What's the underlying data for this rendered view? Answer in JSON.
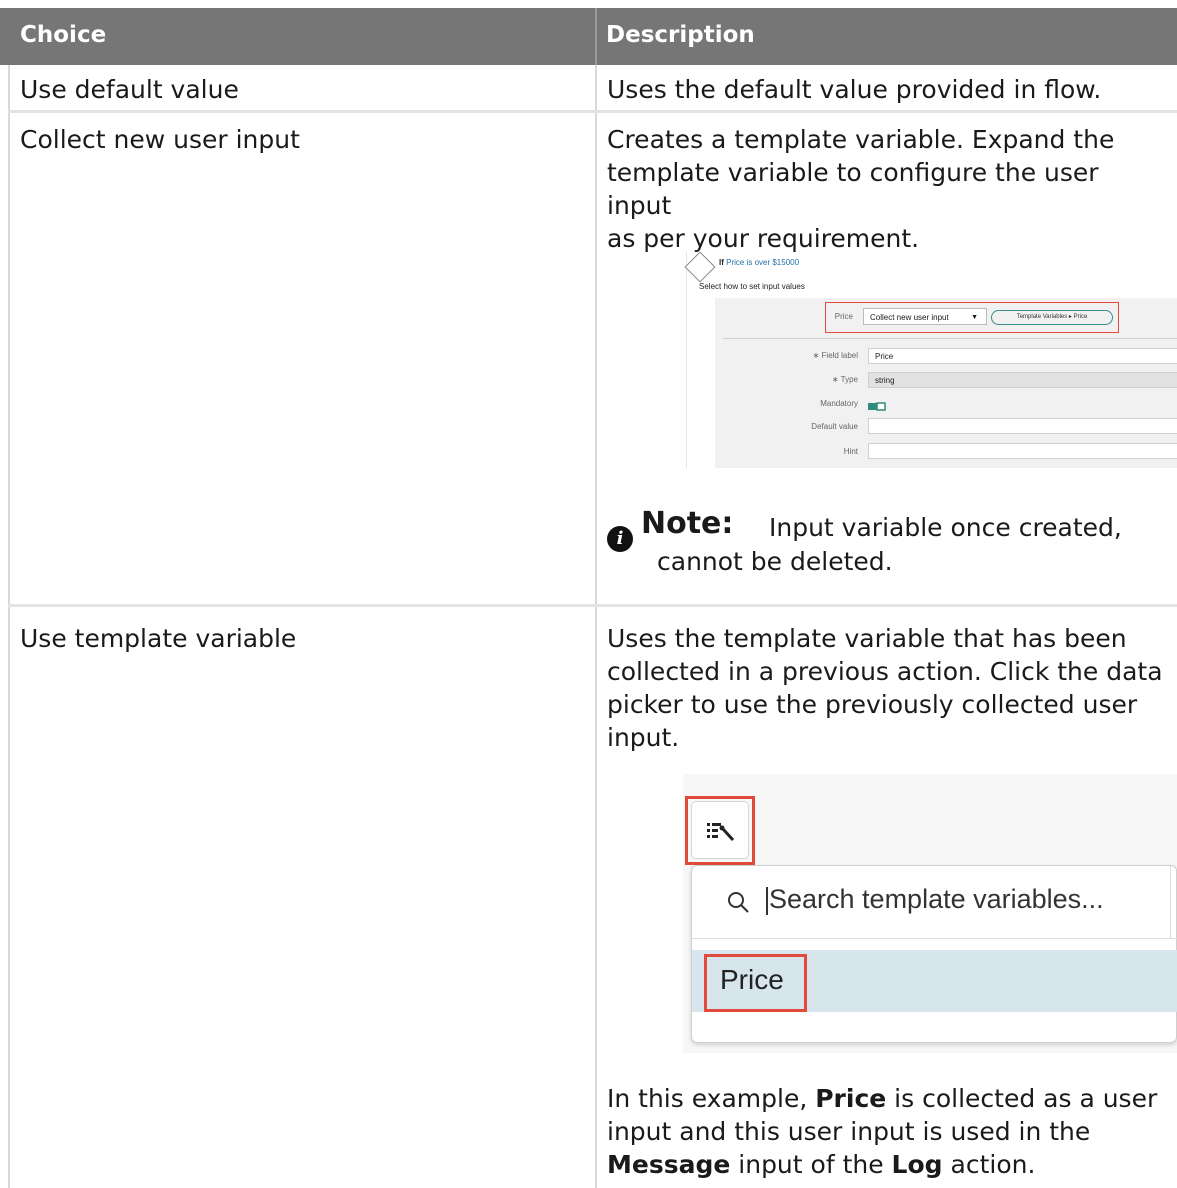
{
  "header": {
    "choice": "Choice",
    "description": "Description"
  },
  "rows": [
    {
      "choice": "Use default value",
      "description": "Uses the default value provided in flow."
    },
    {
      "choice": "Collect new user input",
      "description_lines": [
        "Creates a template variable. Expand the",
        "template variable to configure the user input",
        "as per your requirement."
      ]
    },
    {
      "choice": "Use template variable",
      "description_lines": [
        "Uses the template variable that has been",
        "collected in a previous action. Click the data",
        "picker to use the previously collected user",
        "input."
      ]
    }
  ],
  "shot1": {
    "if_prefix": "If",
    "if_link": "Price is over $15000",
    "select_label": "Select how to set input values",
    "price_label": "Price",
    "dropdown_value": "Collect new user input",
    "pill": "Template Variables ▸ Price",
    "field_label_label": "∗ Field label",
    "field_label_value": "Price",
    "type_label": "∗ Type",
    "type_value": "string",
    "mandatory_label": "Mandatory",
    "default_label": "Default value",
    "hint_label": "Hint",
    "toggle_color": "#2e8b7a"
  },
  "note": {
    "title": "Note:",
    "line1": "Input variable once created,",
    "line2": "cannot be deleted."
  },
  "shot2": {
    "search_placeholder": "Search template variables...",
    "item": "Price",
    "icon": "data-picker-icon"
  },
  "footer_text": {
    "line1_a": "In this example, ",
    "line1_b": "Price",
    "line1_c": " is collected as a user",
    "line2": "input and this user input is used in the",
    "line3_a": "Message",
    "line3_b": " input of the ",
    "line3_c": "Log",
    "line3_d": " action."
  },
  "colors": {
    "header_bg": "#767676",
    "highlight_red": "#e24a3b",
    "selected_row": "#d7e6ec"
  }
}
